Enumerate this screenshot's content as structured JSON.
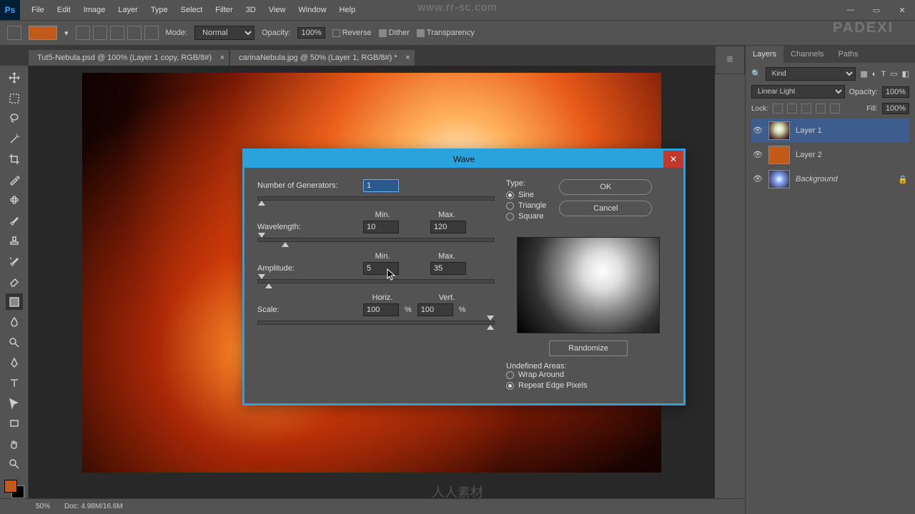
{
  "menubar": [
    "File",
    "Edit",
    "Image",
    "Layer",
    "Type",
    "Select",
    "Filter",
    "3D",
    "View",
    "Window",
    "Help"
  ],
  "optionsbar": {
    "mode_label": "Mode:",
    "mode_value": "Normal",
    "opacity_label": "Opacity:",
    "opacity_value": "100%",
    "reverse": "Reverse",
    "dither": "Dither",
    "transparency": "Transparency"
  },
  "tabs": [
    "Tut5-Nebula.psd @ 100% (Layer 1 copy, RGB/8#)",
    "carinaNebula.jpg @ 50% (Layer 1, RGB/8#) *"
  ],
  "statusbar": {
    "zoom": "50%",
    "doc": "Doc: 4.98M/16.6M"
  },
  "panel": {
    "tabs": [
      "Layers",
      "Channels",
      "Paths"
    ],
    "filter_label": "Kind",
    "blend_mode": "Linear Light",
    "opacity_label": "Opacity:",
    "opacity_value": "100%",
    "lock_label": "Lock:",
    "fill_label": "Fill:",
    "fill_value": "100%",
    "layers": [
      {
        "name": "Layer 1"
      },
      {
        "name": "Layer 2"
      },
      {
        "name": "Background"
      }
    ]
  },
  "dialog": {
    "title": "Wave",
    "num_gen_label": "Number of Generators:",
    "num_gen_value": "1",
    "min_label": "Min.",
    "max_label": "Max.",
    "wavelength_label": "Wavelength:",
    "wavelength_min": "10",
    "wavelength_max": "120",
    "amplitude_label": "Amplitude:",
    "amplitude_min": "5",
    "amplitude_max": "35",
    "horiz_label": "Horiz.",
    "vert_label": "Vert.",
    "scale_label": "Scale:",
    "scale_h": "100",
    "scale_v": "100",
    "pct": "%",
    "type_label": "Type:",
    "type_options": [
      "Sine",
      "Triangle",
      "Square"
    ],
    "ok": "OK",
    "cancel": "Cancel",
    "randomize": "Randomize",
    "undef_label": "Undefined Areas:",
    "undef_options": [
      "Wrap Around",
      "Repeat Edge Pixels"
    ]
  },
  "watermarks": {
    "top": "www.rr-sc.com",
    "brand": "PADEXI",
    "bottom": "人人素材"
  }
}
